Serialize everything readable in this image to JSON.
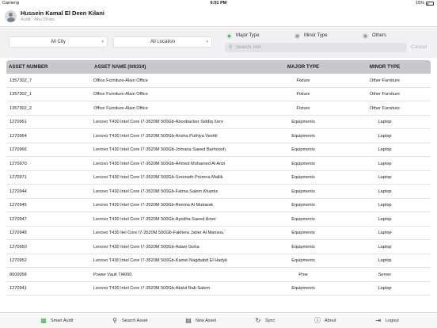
{
  "status_bar": {
    "carrier": "Carrier",
    "time": "6:51 PM",
    "battery": "15%"
  },
  "header": {
    "name": "Hussein Kamal El Deen Kilani",
    "subtitle": "Audit - Abu Dhabi"
  },
  "filters": {
    "city": "All City",
    "location": "All Location",
    "radio_options": [
      {
        "label": "Major Type",
        "selected": true
      },
      {
        "label": "Minor Type",
        "selected": false
      },
      {
        "label": "Others",
        "selected": false
      }
    ],
    "search_placeholder": "Search Text",
    "cancel_label": "Cancel"
  },
  "table": {
    "headers": {
      "asset_number": "ASSET NUMBER",
      "asset_name": "ASSET NAME (0/8334)",
      "major_type": "MAJOR TYPE",
      "minor_type": "MINOR TYPE"
    },
    "rows": [
      {
        "number": "1357302_7",
        "name": "Office Furniture-Alain Office",
        "major": "Fixture",
        "minor": "Other Furniture"
      },
      {
        "number": "1357302_1",
        "name": "Office Furniture-Alain Office",
        "major": "Fixture",
        "minor": "Other Furniture"
      },
      {
        "number": "1357302_2",
        "name": "Office Furniture-Alain Office",
        "major": "Fixture",
        "minor": "Other Furniture"
      },
      {
        "number": "1270961",
        "name": "Lenovo T430 Intel Core I7-3520M 500Gb-Aboobacker Siddiq Xero",
        "major": "Equipments",
        "minor": "Laptop"
      },
      {
        "number": "1270964",
        "name": "Lenovo T430 Intel Core I7-3520M 500Gb-Ansha Puthiya Veettil",
        "major": "Equipments",
        "minor": "Laptop"
      },
      {
        "number": "1270966",
        "name": "Lenovo T430 Intel Core I7-3520M 500Gb-Jomana Saeed Barhoosh",
        "major": "Equipments",
        "minor": "Laptop"
      },
      {
        "number": "1270970",
        "name": "Lenovo T430 Intel Core I7-3520M 500Gb-Ahmed Mohamed Al Anzi",
        "major": "Equipments",
        "minor": "Laptop"
      },
      {
        "number": "1270971",
        "name": "Lenovo T430 Intel Core I7-3520M 500Gb-Sreenath Premna Mallik",
        "major": "Equipments",
        "minor": "Laptop"
      },
      {
        "number": "1270944",
        "name": "Lenovo T430 Intel Core I7-3520M 500Gb-Fatma Salem Khamis",
        "major": "Equipments",
        "minor": "Laptop"
      },
      {
        "number": "1270945",
        "name": "Lenovo T430 Intel Core I7-3520M 500Gb-Reema Al Mubarak",
        "major": "Equipments",
        "minor": "Laptop"
      },
      {
        "number": "1270947",
        "name": "Lenovo T430 Intel Core I7-3520M 500Gb-Ayedha Saeed Amer",
        "major": "Equipments",
        "minor": "Laptop"
      },
      {
        "number": "1270948",
        "name": "Lenovo T430 Itel Core I7-3520M 500Gb-Fakhera Jaber Al Mansou",
        "major": "Equipments",
        "minor": "Laptop"
      },
      {
        "number": "1270950",
        "name": "Lenovo T430 Intel Core I7-3520M 500Gb-Adam Goha",
        "major": "Equipments",
        "minor": "Laptop"
      },
      {
        "number": "1270952",
        "name": "Lenovo T430 Intel Core I7-3520M 500Gb-Kamel Nagibabd El Hadyk",
        "major": "Equipments",
        "minor": "Laptop"
      },
      {
        "number": "8000058",
        "name": "Power Vault Tl4000",
        "major": "Pme",
        "minor": "Server"
      },
      {
        "number": "1270941",
        "name": "Lenovo T430 Intel Core I7-3520M 500Gb-Abdul Rab Salem",
        "major": "Equipments",
        "minor": "Laptop"
      }
    ]
  },
  "tabbar": {
    "items": [
      {
        "label": "Smart Audit",
        "icon": "smart-audit-icon"
      },
      {
        "label": "Search Asset",
        "icon": "search-icon"
      },
      {
        "label": "New Asset",
        "icon": "new-asset-icon"
      },
      {
        "label": "Sync",
        "icon": "sync-icon"
      },
      {
        "label": "About",
        "icon": "info-icon"
      },
      {
        "label": "Logout",
        "icon": "logout-icon"
      }
    ]
  },
  "colors": {
    "accent_green": "#2fae49",
    "header_gray": "#c8c8cc",
    "filter_bg": "#f1f1f3"
  }
}
